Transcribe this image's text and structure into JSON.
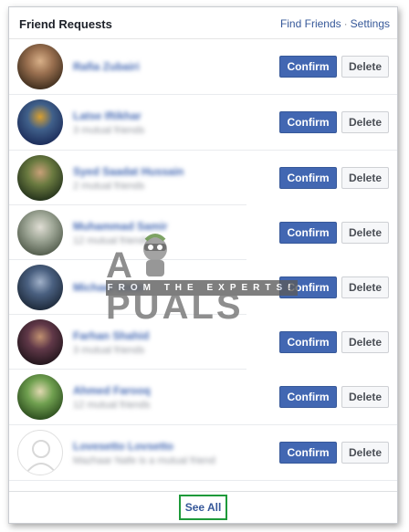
{
  "header": {
    "title": "Friend Requests",
    "find_friends": "Find Friends",
    "separator": "·",
    "settings": "Settings"
  },
  "requests": [
    {
      "name": "Rafia Zubairi",
      "mutual": "",
      "avatar_colors": [
        "#3c2c1c",
        "#9a7050",
        "#d8b088"
      ],
      "avatar_icon": "person-photo-icon"
    },
    {
      "name": "Latse Iftikhar",
      "mutual": "3 mutual friends",
      "avatar_colors": [
        "#1a2a58",
        "#40608a",
        "#d8a030"
      ],
      "avatar_icon": "person-photo-icon"
    },
    {
      "name": "Syed Saadat Hussain",
      "mutual": "2 mutual friends",
      "avatar_colors": [
        "#22301a",
        "#6a7a40",
        "#c8a078"
      ],
      "avatar_icon": "person-photo-icon"
    },
    {
      "name": "Muhammad Samir",
      "mutual": "12 mutual friends",
      "avatar_colors": [
        "#505a4a",
        "#a0a898",
        "#e0ddd4"
      ],
      "avatar_icon": "person-photo-icon"
    },
    {
      "name": "Michael Umer",
      "mutual": "",
      "avatar_colors": [
        "#1c2838",
        "#4a6080",
        "#a0b0c8"
      ],
      "avatar_icon": "person-photo-icon"
    },
    {
      "name": "Farhan Shahid",
      "mutual": "3 mutual friends",
      "avatar_colors": [
        "#20141a",
        "#603848",
        "#c09070"
      ],
      "avatar_icon": "person-photo-icon"
    },
    {
      "name": "Ahmed Farooq",
      "mutual": "12 mutual friends",
      "avatar_colors": [
        "#2a4a1c",
        "#70a050",
        "#e0d8b0"
      ],
      "avatar_icon": "person-photo-icon"
    },
    {
      "name": "Lovesetto Lovsetto",
      "mutual": "Mazhaar Nafe is a mutual friend",
      "avatar_colors": [
        "#eeeeee",
        "#dddddd",
        "#f6f6f6"
      ],
      "avatar_icon": "default-avatar-icon"
    }
  ],
  "actions": {
    "confirm_label": "Confirm",
    "delete_label": "Delete"
  },
  "footer": {
    "see_all_label": "See All",
    "highlight_color": "#1e9a3a"
  },
  "watermark": {
    "logo": "APPUALS",
    "tagline": "FROM THE EXPERTS!"
  },
  "colors": {
    "confirm_bg": "#4267b2",
    "link": "#365899",
    "name": "#4267b2"
  }
}
